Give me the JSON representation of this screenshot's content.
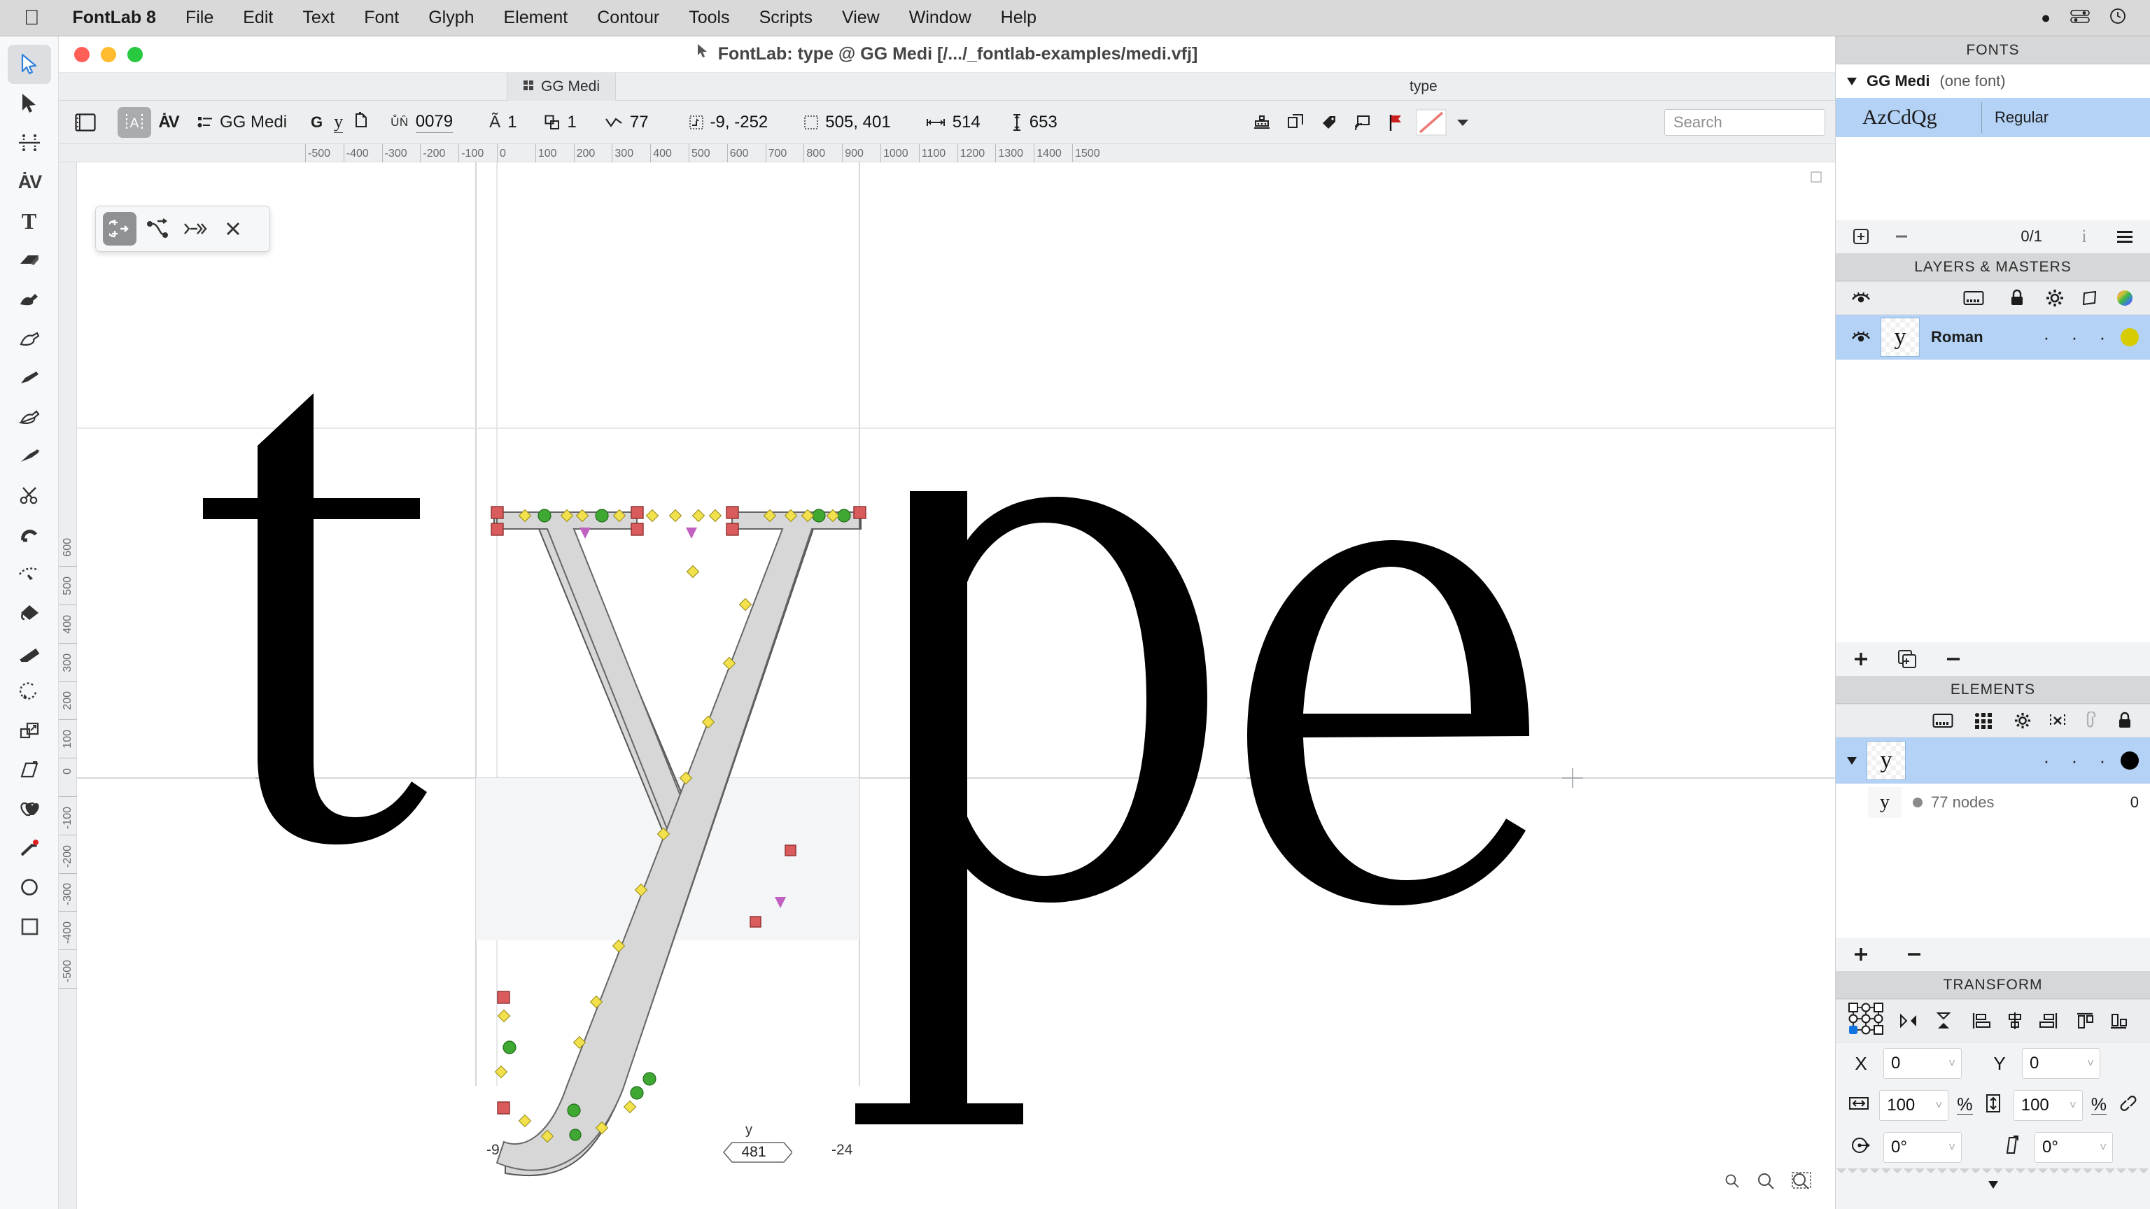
{
  "menubar": {
    "apple_icon": "apple-logo",
    "app": "FontLab 8",
    "items": [
      "File",
      "Edit",
      "Text",
      "Font",
      "Glyph",
      "Element",
      "Contour",
      "Tools",
      "Scripts",
      "View",
      "Window",
      "Help"
    ],
    "status_icons": [
      "control-center-icon",
      "battery-icon",
      "clock-icon"
    ]
  },
  "window": {
    "title": "FontLab: type @ GG Medi [/.../_fontlab-examples/medi.vfj]",
    "cursor_glyph": "arrow-cursor-icon",
    "traffic_lights": [
      "close",
      "minimize",
      "zoom"
    ]
  },
  "tabstrip": {
    "tab_label": "GG Medi",
    "tab_icon": "grid-icon",
    "right_label": "type"
  },
  "toolbar": {
    "panel_toggle_icon": "sidebar-panel-icon",
    "glyph_mode_icon": "glyph-A-icon",
    "kerning_mode_icon": "kerning-AV-icon",
    "font_menu_icon": "list-icon",
    "font_name": "GG Medi",
    "glyph_group_label": "G",
    "glyph_name": "y",
    "copy_icon": "duplicate-glyph-icon",
    "fields": [
      {
        "icon": "unicode-icon",
        "label": "UNI",
        "value": "0079",
        "underlined": true
      },
      {
        "icon": "alt-layers-icon",
        "label": "Ã",
        "value": "1"
      },
      {
        "icon": "elements-icon",
        "label": "elements",
        "value": "1"
      },
      {
        "icon": "nodes-icon",
        "label": "nodes",
        "value": "77"
      },
      {
        "icon": "bbox-origin-icon",
        "label": "origin",
        "value": "-9, -252"
      },
      {
        "icon": "bbox-size-icon",
        "label": "size",
        "value": "505, 401"
      },
      {
        "icon": "width-icon",
        "label": "width",
        "value": "514"
      },
      {
        "icon": "height-icon",
        "label": "height",
        "value": "653"
      }
    ],
    "right_icons": [
      "anchors-icon",
      "components-icon",
      "tags-icon",
      "guides-icon",
      "flag-icon"
    ],
    "color_swatch_icon": "no-color-diagonal-icon",
    "dropdown_icon": "chevron-down-icon",
    "search_placeholder": "Search"
  },
  "tools": [
    {
      "name": "edit-tool",
      "icon": "arrow-blue",
      "selected": true
    },
    {
      "name": "select-tool",
      "icon": "arrow-black",
      "selected": false
    },
    {
      "name": "metrics-tool",
      "icon": "metrics",
      "selected": false
    },
    {
      "name": "kerning-tool",
      "icon": "AV",
      "selected": false
    },
    {
      "name": "text-tool",
      "icon": "T",
      "selected": false
    },
    {
      "name": "eraser-tool",
      "icon": "eraser",
      "selected": false
    },
    {
      "name": "paint-brush-tool",
      "icon": "brush",
      "selected": false
    },
    {
      "name": "pen-tool",
      "icon": "pen",
      "selected": false
    },
    {
      "name": "pencil-tool",
      "icon": "pencil",
      "selected": false
    },
    {
      "name": "rapid-tool",
      "icon": "rapid",
      "selected": false
    },
    {
      "name": "brush-tool",
      "icon": "calligraphy",
      "selected": false
    },
    {
      "name": "knife-tool",
      "icon": "scissors",
      "selected": false
    },
    {
      "name": "magnet-tool",
      "icon": "magnet",
      "selected": false
    },
    {
      "name": "scissors-tool",
      "icon": "slice",
      "selected": false
    },
    {
      "name": "paint-bucket-tool",
      "icon": "bucket",
      "selected": false
    },
    {
      "name": "measure-tool",
      "icon": "ruler",
      "selected": false
    },
    {
      "name": "rotate-tool",
      "icon": "rotate",
      "selected": false
    },
    {
      "name": "scale-tool",
      "icon": "scale",
      "selected": false
    },
    {
      "name": "slant-tool",
      "icon": "slant",
      "selected": false
    },
    {
      "name": "shape-merge-tool",
      "icon": "merge",
      "selected": false
    },
    {
      "name": "add-point-tool",
      "icon": "addpoint",
      "selected": false
    },
    {
      "name": "ellipse-tool",
      "icon": "circle",
      "selected": false
    },
    {
      "name": "rectangle-tool",
      "icon": "square",
      "selected": false
    }
  ],
  "floating_toolbar": {
    "buttons": [
      {
        "name": "harmonize-button",
        "icon": "harmonize-arrow-icon",
        "selected": true
      },
      {
        "name": "smooth-nodes-button",
        "icon": "node-curve-icon",
        "selected": false
      },
      {
        "name": "convert-button",
        "icon": "arrow-converge-icon",
        "selected": false
      },
      {
        "name": "close-toolbar-button",
        "icon": "close-x-icon",
        "selected": false
      }
    ]
  },
  "canvas": {
    "ruler_h_ticks": [
      "-500",
      "-400",
      "-300",
      "-200",
      "-100",
      "0",
      "100",
      "200",
      "300",
      "400",
      "500",
      "600",
      "700",
      "800",
      "900",
      "1000",
      "1100",
      "1200",
      "1300",
      "1400",
      "1500"
    ],
    "ruler_v_ticks": [
      "600",
      "500",
      "400",
      "300",
      "200",
      "100",
      "0",
      "-100",
      "-200",
      "-300",
      "-400",
      "-500"
    ],
    "glyph_string": "type",
    "measurements": {
      "left_sidebearing": "-9",
      "right_sidebearing": "-24",
      "advance_label": "y",
      "advance_width": "481"
    },
    "zoom_icons": [
      "zoom-out-icon",
      "zoom-100-icon",
      "zoom-fit-icon"
    ]
  },
  "panels": {
    "fonts": {
      "title": "FONTS",
      "family_name": "GG Medi",
      "family_note": "(one font)",
      "rows": [
        {
          "preview": "AzCdQg",
          "style": "Regular",
          "selected": true
        }
      ],
      "footer": {
        "add_icon": "add-font-icon",
        "remove_icon": "remove-font-icon",
        "counter": "0/1",
        "info_icon": "info-icon",
        "menu_icon": "hamburger-icon"
      }
    },
    "layers": {
      "title": "LAYERS & MASTERS",
      "header_icons": [
        "metrics-icon",
        "lock-icon",
        "gear-icon",
        "shape-icon",
        "color-wheel-icon"
      ],
      "eye_icon": "eye-icon",
      "rows": [
        {
          "thumb": "y",
          "name": "Roman",
          "dots": [
            "·",
            "·",
            "·"
          ],
          "swatch": "#d6cc00",
          "selected": true
        }
      ],
      "footer_icons": [
        "add-layer-icon",
        "duplicate-layer-icon",
        "remove-layer-icon"
      ]
    },
    "elements": {
      "title": "ELEMENTS",
      "header_icons": [
        "metrics-icon",
        "grid-icon",
        "gear-icon",
        "mirror-icon",
        "link-icon",
        "lock-icon"
      ],
      "rows": [
        {
          "thumb": "y",
          "name": "",
          "dots": [
            "·",
            "·",
            "·"
          ],
          "swatch": "#000000",
          "selected": true,
          "expandable": true
        },
        {
          "thumb": "y",
          "name": "77 nodes",
          "value": "0",
          "selected": false,
          "bullet": "#8a8a8a"
        }
      ],
      "footer_icons": [
        "add-element-icon",
        "remove-element-icon"
      ]
    },
    "transform": {
      "title": "TRANSFORM",
      "origin_icon": "transform-origin-grid-icon",
      "action_icons": [
        "flip-horizontal-icon",
        "flip-vertical-icon",
        "align-left-icon",
        "align-center-icon",
        "align-right-icon",
        "align-top-icon",
        "align-bottom-icon"
      ],
      "fields": {
        "x_label": "X",
        "x_value": "0",
        "y_label": "Y",
        "y_value": "0",
        "w_icon": "width-scale-icon",
        "w_value": "100",
        "w_unit": "%",
        "h_icon": "height-scale-icon",
        "h_value": "100",
        "h_unit": "%",
        "link_icon": "link-chain-icon",
        "rotate_icon": "rotate-icon",
        "rotate_value": "0°",
        "slant_icon": "slant-icon",
        "slant_value": "0°"
      },
      "collapse_icon": "chevron-down-icon"
    }
  }
}
